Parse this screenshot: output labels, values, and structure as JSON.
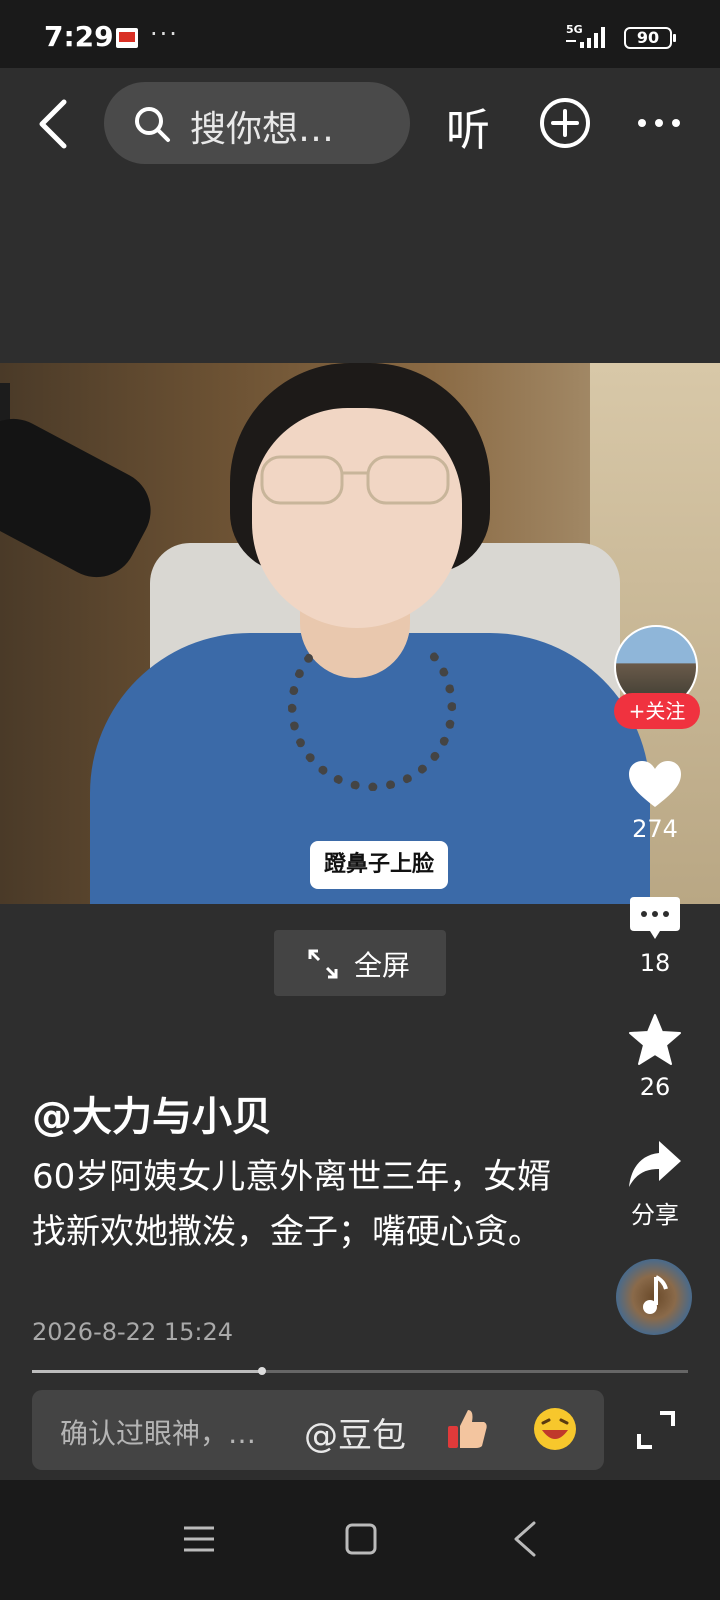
{
  "status_bar": {
    "time": "7:29",
    "more": "···",
    "network": "5G",
    "battery": "90"
  },
  "top_bar": {
    "search_placeholder": "搜你想…",
    "listen_label": "听"
  },
  "video": {
    "caption": "蹬鼻子上脸",
    "fullscreen_label": "全屏"
  },
  "side_rail": {
    "follow_label": "+关注",
    "likes": "274",
    "comments": "18",
    "favorites": "26",
    "share_label": "分享"
  },
  "post": {
    "author": "@大力与小贝",
    "description": "60岁阿姨女儿意外离世三年，女婿找新欢她撒泼，金子；嘴硬心贪。",
    "date": "2026-8-22 15:24",
    "progress": 0.35
  },
  "comment_bar": {
    "placeholder": "确认过眼神，…",
    "mention": "@豆包"
  },
  "colors": {
    "background": "#2e2e2e",
    "follow_red": "#f0323f",
    "search_bg": "#4a4a4a"
  }
}
